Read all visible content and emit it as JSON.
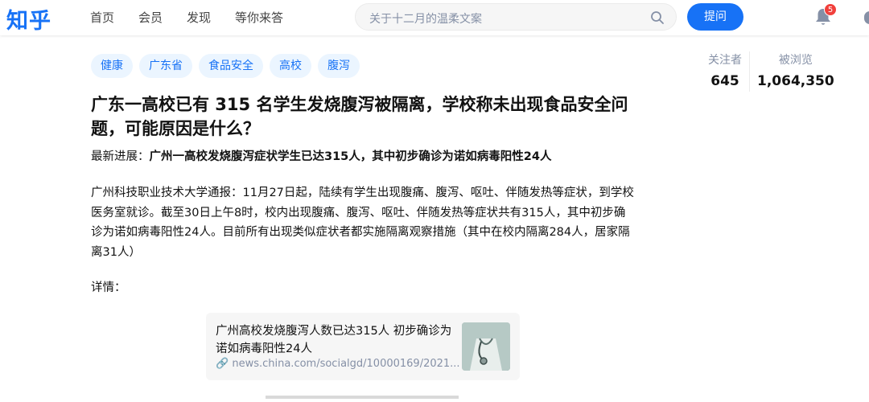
{
  "header": {
    "logo": "知乎",
    "nav": [
      "首页",
      "会员",
      "发现",
      "等你来答"
    ],
    "search_placeholder": "关于十二月的温柔文案",
    "ask_label": "提问",
    "notification_count": "5"
  },
  "tags": [
    "健康",
    "广东省",
    "食品安全",
    "高校",
    "腹泻"
  ],
  "question": {
    "title": "广东一高校已有 315 名学生发烧腹泻被隔离，学校称未出现食品安全问题，可能原因是什么？",
    "progress_label": "最新进展：",
    "progress_text": "广州一高校发烧腹泻症状学生已达315人，其中初步确诊为诺如病毒阳性24人",
    "body": "广州科技职业技术大学通报：11月27日起，陆续有学生出现腹痛、腹泻、呕吐、伴随发热等症状，到学校医务室就诊。截至30日上午8时，校内出现腹痛、腹泻、呕吐、伴随发热等症状共有315人，其中初步确诊为诺如病毒阳性24人。目前所有出现类似症状者都实施隔离观察措施（其中在校内隔离284人，居家隔离31人）",
    "detail_label": "详情："
  },
  "stats": {
    "followers_label": "关注者",
    "followers_value": "645",
    "views_label": "被浏览",
    "views_value": "1,064,350"
  },
  "link_card": {
    "title": "广州高校发烧腹泻人数已达315人 初步确诊为诺如病毒阳性24人",
    "url": "news.china.com/socialgd/10000169/2021..."
  },
  "colors": {
    "brand": "#1772f6",
    "tag_bg": "#ebf5ff",
    "badge": "#f1403c"
  }
}
